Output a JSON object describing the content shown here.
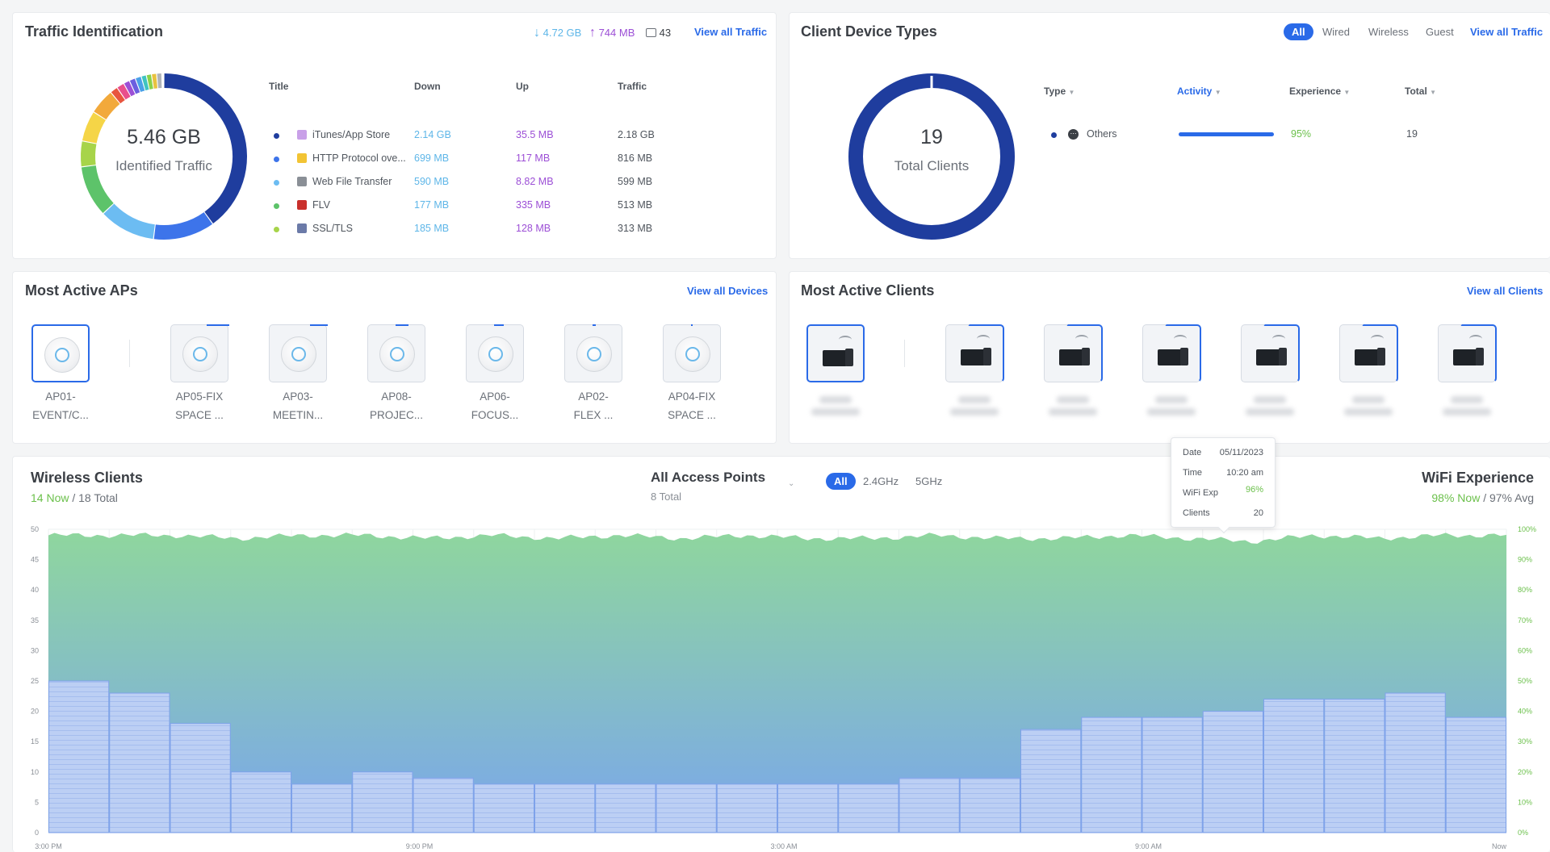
{
  "traffic": {
    "title": "Traffic Identification",
    "down_total": "4.72 GB",
    "up_total": "744 MB",
    "apps_count": "43",
    "view_all": "View all Traffic",
    "center_value": "5.46 GB",
    "center_label": "Identified Traffic",
    "columns": [
      "Title",
      "Down",
      "Up",
      "Traffic"
    ],
    "rows": [
      {
        "title": "iTunes/App Store",
        "down": "2.14 GB",
        "up": "35.5 MB",
        "traffic": "2.18 GB",
        "color": "#1f3d9e",
        "icon": "app-store-icon"
      },
      {
        "title": "HTTP Protocol ove...",
        "down": "699 MB",
        "up": "117 MB",
        "traffic": "816 MB",
        "color": "#3d74ea",
        "icon": "lock-icon"
      },
      {
        "title": "Web File Transfer",
        "down": "590 MB",
        "up": "8.82 MB",
        "traffic": "599 MB",
        "color": "#6cbcf2",
        "icon": "file-icon"
      },
      {
        "title": "FLV",
        "down": "177 MB",
        "up": "335 MB",
        "traffic": "513 MB",
        "color": "#5dc36a",
        "icon": "flv-icon"
      },
      {
        "title": "SSL/TLS",
        "down": "185 MB",
        "up": "128 MB",
        "traffic": "313 MB",
        "color": "#a7d44a",
        "icon": "shield-icon"
      }
    ]
  },
  "clients_types": {
    "title": "Client Device Types",
    "filters": [
      "All",
      "Wired",
      "Wireless",
      "Guest"
    ],
    "active_filter": "All",
    "view_all": "View all Traffic",
    "center_value": "19",
    "center_label": "Total Clients",
    "columns": [
      "Type",
      "Activity",
      "Experience",
      "Total"
    ],
    "rows": [
      {
        "type": "Others",
        "activity": 1.0,
        "experience": "95%",
        "total": "19"
      }
    ]
  },
  "aps": {
    "title": "Most Active APs",
    "view_all": "View all Devices",
    "items": [
      {
        "l1": "AP01-",
        "l2": "EVENT/C..."
      },
      {
        "l1": "AP05-FIX",
        "l2": "SPACE ..."
      },
      {
        "l1": "AP03-",
        "l2": "MEETIN..."
      },
      {
        "l1": "AP08-",
        "l2": "PROJEC..."
      },
      {
        "l1": "AP06-",
        "l2": "FOCUS..."
      },
      {
        "l1": "AP02-",
        "l2": "FLEX ..."
      },
      {
        "l1": "AP04-FIX",
        "l2": "SPACE ..."
      }
    ]
  },
  "active_clients": {
    "title": "Most Active Clients",
    "view_all": "View all Clients"
  },
  "wireless": {
    "title": "Wireless Clients",
    "now": "14 Now",
    "total": "/ 18 Total",
    "ap_selector": "All Access Points",
    "ap_total": "8 Total",
    "bands": [
      "All",
      "2.4GHz",
      "5GHz"
    ],
    "active_band": "All",
    "exp_title": "WiFi Experience",
    "exp_now": "98% Now",
    "exp_avg": "/ 97% Avg"
  },
  "tooltip": {
    "date_label": "Date",
    "date": "05/11/2023",
    "time_label": "Time",
    "time": "10:20 am",
    "exp_label": "WiFi Exp",
    "exp": "96%",
    "clients_label": "Clients",
    "clients": "20"
  },
  "chart_data": {
    "type": "bar",
    "x_ticks": [
      "3:00 PM",
      "9:00 PM",
      "3:00 AM",
      "9:00 AM",
      "Now"
    ],
    "y_left_ticks": [
      "0",
      "5",
      "10",
      "15",
      "20",
      "25",
      "30",
      "35",
      "40",
      "45",
      "50"
    ],
    "y_right_ticks": [
      "0%",
      "10%",
      "20%",
      "30%",
      "40%",
      "50%",
      "60%",
      "70%",
      "80%",
      "90%",
      "100%"
    ],
    "ylim_left": [
      0,
      50
    ],
    "ylim_right": [
      0,
      100
    ],
    "series": [
      {
        "values": [
          25,
          23,
          18,
          10,
          8,
          10,
          9,
          8,
          8,
          8,
          8,
          8,
          8,
          8,
          9,
          9,
          17,
          19,
          19,
          20,
          22,
          22,
          23,
          19
        ]
      },
      {
        "values": [
          98,
          98,
          98,
          97,
          98,
          98,
          97,
          98,
          97,
          98,
          97,
          98,
          97,
          97,
          98,
          97,
          97,
          98,
          97,
          96,
          98,
          97,
          98,
          98
        ]
      }
    ],
    "colors": {
      "bars": "#b7cbf3",
      "bar_edge": "#7ea2ea",
      "area_top": "#8fd69e",
      "area_bottom": "#7aa6ec"
    }
  }
}
